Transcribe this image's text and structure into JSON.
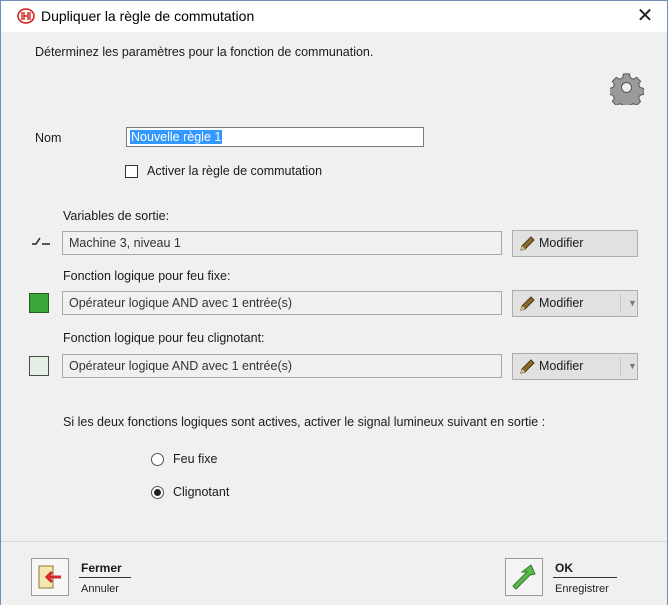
{
  "window": {
    "title": "Dupliquer la règle de commutation",
    "close_symbol": "✕"
  },
  "description": "Déterminez les paramètres pour la fonction de communation.",
  "name_field": {
    "label": "Nom",
    "value": "Nouvelle règle 1"
  },
  "activate_rule": {
    "label": "Activer la règle de commutation",
    "checked": false
  },
  "output_variables": {
    "label": "Variables de sortie:",
    "value": "Machine 3, niveau 1",
    "button_label": "Modifier",
    "icon": "switch-icon"
  },
  "steady_light": {
    "label": "Fonction logique pour feu fixe:",
    "value": "Opérateur logique AND avec 1 entrée(s)",
    "button_label": "Modifier",
    "color": "#3aa53a"
  },
  "blinking_light": {
    "label": "Fonction logique pour feu clignotant:",
    "value": "Opérateur logique AND avec 1 entrée(s)",
    "button_label": "Modifier",
    "color": "#e6efe6"
  },
  "signal_question": "Si les deux fonctions logiques sont actives, activer le signal lumineux suivant en sortie :",
  "signal_options": [
    {
      "label": "Feu fixe",
      "selected": false
    },
    {
      "label": "Clignotant",
      "selected": true
    }
  ],
  "footer": {
    "close": {
      "label": "Fermer",
      "sublabel": "Annuler"
    },
    "ok": {
      "label": "OK",
      "sublabel": "Enregistrer"
    }
  }
}
